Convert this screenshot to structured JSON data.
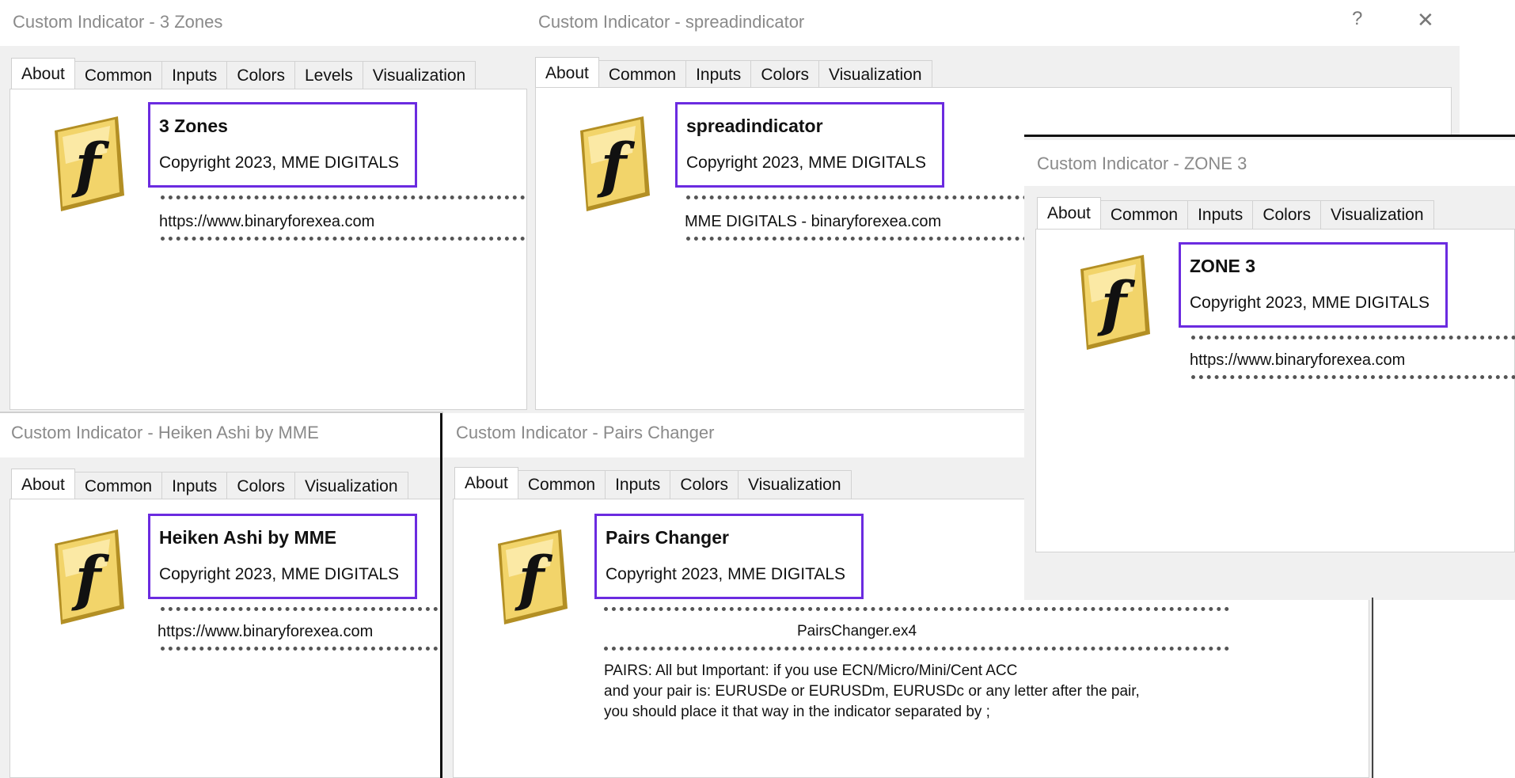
{
  "tabs_long": [
    "About",
    "Common",
    "Inputs",
    "Colors",
    "Levels",
    "Visualization"
  ],
  "tabs_short": [
    "About",
    "Common",
    "Inputs",
    "Colors",
    "Visualization"
  ],
  "dialogs": {
    "zones3": {
      "title": "Custom Indicator - 3 Zones",
      "name": "3 Zones",
      "copyright": "Copyright 2023, MME DIGITALS",
      "link": "https://www.binaryforexea.com"
    },
    "spread": {
      "title": "Custom Indicator - spreadindicator",
      "name": "spreadindicator",
      "copyright": "Copyright 2023, MME DIGITALS",
      "link": "MME DIGITALS - binaryforexea.com",
      "help_glyph": "?",
      "close_glyph": "✕"
    },
    "zone3": {
      "title": "Custom Indicator - ZONE 3",
      "name": "ZONE 3",
      "copyright": "Copyright 2023, MME DIGITALS",
      "link": "https://www.binaryforexea.com"
    },
    "heiken": {
      "title": "Custom Indicator - Heiken Ashi by MME",
      "name": "Heiken Ashi by MME",
      "copyright": "Copyright 2023, MME DIGITALS",
      "link": "https://www.binaryforexea.com"
    },
    "pairs": {
      "title": "Custom Indicator - Pairs Changer",
      "name": "Pairs Changer",
      "copyright": "Copyright 2023, MME DIGITALS",
      "file": "PairsChanger.ex4",
      "desc_lines": [
        "PAIRS: All but Important: if you use ECN/Micro/Mini/Cent ACC",
        "and your pair is: EURUSDe or EURUSDm, EURUSDc or any letter after the pair,",
        "you should place it that way in the indicator separated by ;"
      ]
    }
  },
  "colors": {
    "highlight_box": "#6b2be0",
    "logo_gold": "#e9c948",
    "title_text": "#8a8a8a"
  }
}
